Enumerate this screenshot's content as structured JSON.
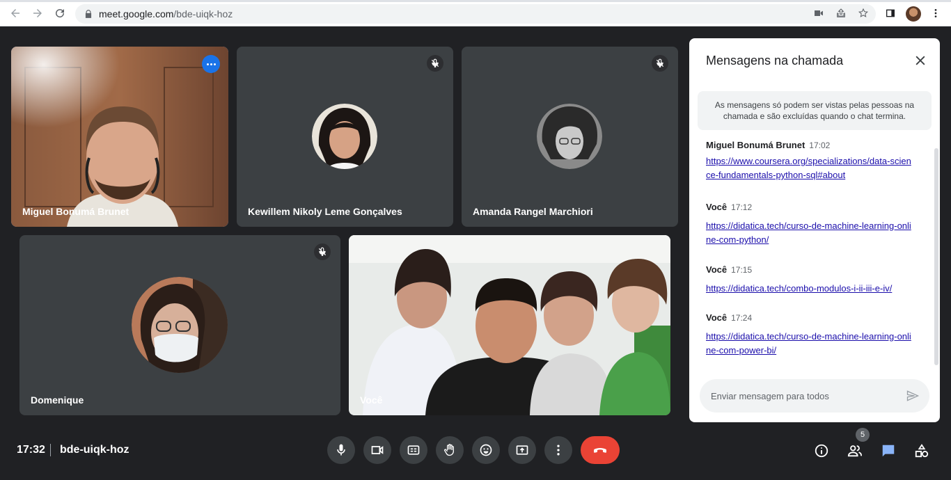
{
  "browser": {
    "url_host": "meet.google.com",
    "url_path": "/bde-uiqk-hoz"
  },
  "tiles": [
    {
      "name": "Miguel Bonumá Brunet",
      "mic_muted": false,
      "video_on": true,
      "active": true
    },
    {
      "name": "Kewillem Nikoly Leme Gonçalves",
      "mic_muted": true,
      "video_on": false
    },
    {
      "name": "Amanda Rangel Marchiori",
      "mic_muted": true,
      "video_on": false
    },
    {
      "name": "Domenique",
      "mic_muted": true,
      "video_on": false
    },
    {
      "name": "Você",
      "mic_muted": false,
      "video_on": true
    }
  ],
  "chat": {
    "title": "Mensagens na chamada",
    "notice": "As mensagens só podem ser vistas pelas pessoas na chamada e são excluídas quando o chat termina.",
    "messages": [
      {
        "sender": "Miguel Bonumá Brunet",
        "time": "17:02",
        "text": "https://www.coursera.org/specializations/data-science-fundamentals-python-sql#about"
      },
      {
        "sender": "Você",
        "time": "17:12",
        "text": "https://didatica.tech/curso-de-machine-learning-online-com-python/"
      },
      {
        "sender": "Você",
        "time": "17:15",
        "text": "https://didatica.tech/combo-modulos-i-ii-iii-e-iv/"
      },
      {
        "sender": "Você",
        "time": "17:24",
        "text": "https://didatica.tech/curso-de-machine-learning-online-com-power-bi/"
      }
    ],
    "input_placeholder": "Enviar mensagem para todos"
  },
  "bottom": {
    "time": "17:32",
    "meeting_code": "bde-uiqk-hoz",
    "participants_count": "5"
  },
  "colors": {
    "background": "#202124",
    "tile": "#3c4043",
    "hangup": "#ea4335",
    "link": "#1a0dab",
    "chat_icon": "#8ab4f8"
  }
}
